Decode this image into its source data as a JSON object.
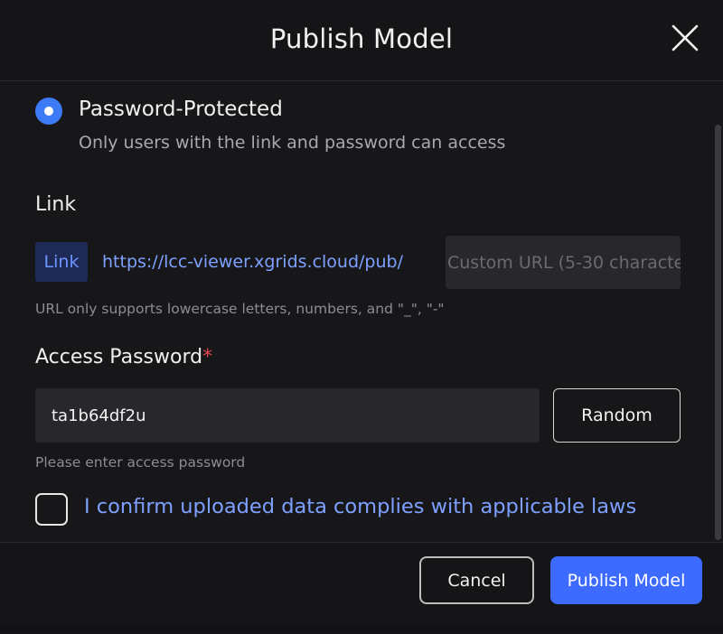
{
  "dialog": {
    "title": "Publish Model",
    "close_icon": "close-icon"
  },
  "access_mode": {
    "label": "Password-Protected",
    "description": "Only users with the link and password can access",
    "selected": true
  },
  "link_section": {
    "label": "Link",
    "tag": "Link",
    "prefix": "https://lcc-viewer.xgrids.cloud/pub/",
    "custom_url_placeholder": "Custom URL (5-30 characte",
    "custom_url_value": "",
    "hint": "URL only supports lowercase letters, numbers, and \"_\", \"-\""
  },
  "password_section": {
    "label": "Access Password",
    "required_mark": "*",
    "value": "ta1b64df2u",
    "random_button": "Random",
    "hint": "Please enter access password"
  },
  "compliance": {
    "label": "I confirm uploaded data complies with applicable laws",
    "checked": false
  },
  "footer": {
    "cancel_label": "Cancel",
    "publish_label": "Publish Model"
  },
  "colors": {
    "accent": "#3d6bff",
    "link_text": "#7ea0ff",
    "required": "#e5484d",
    "background": "#17171a"
  }
}
